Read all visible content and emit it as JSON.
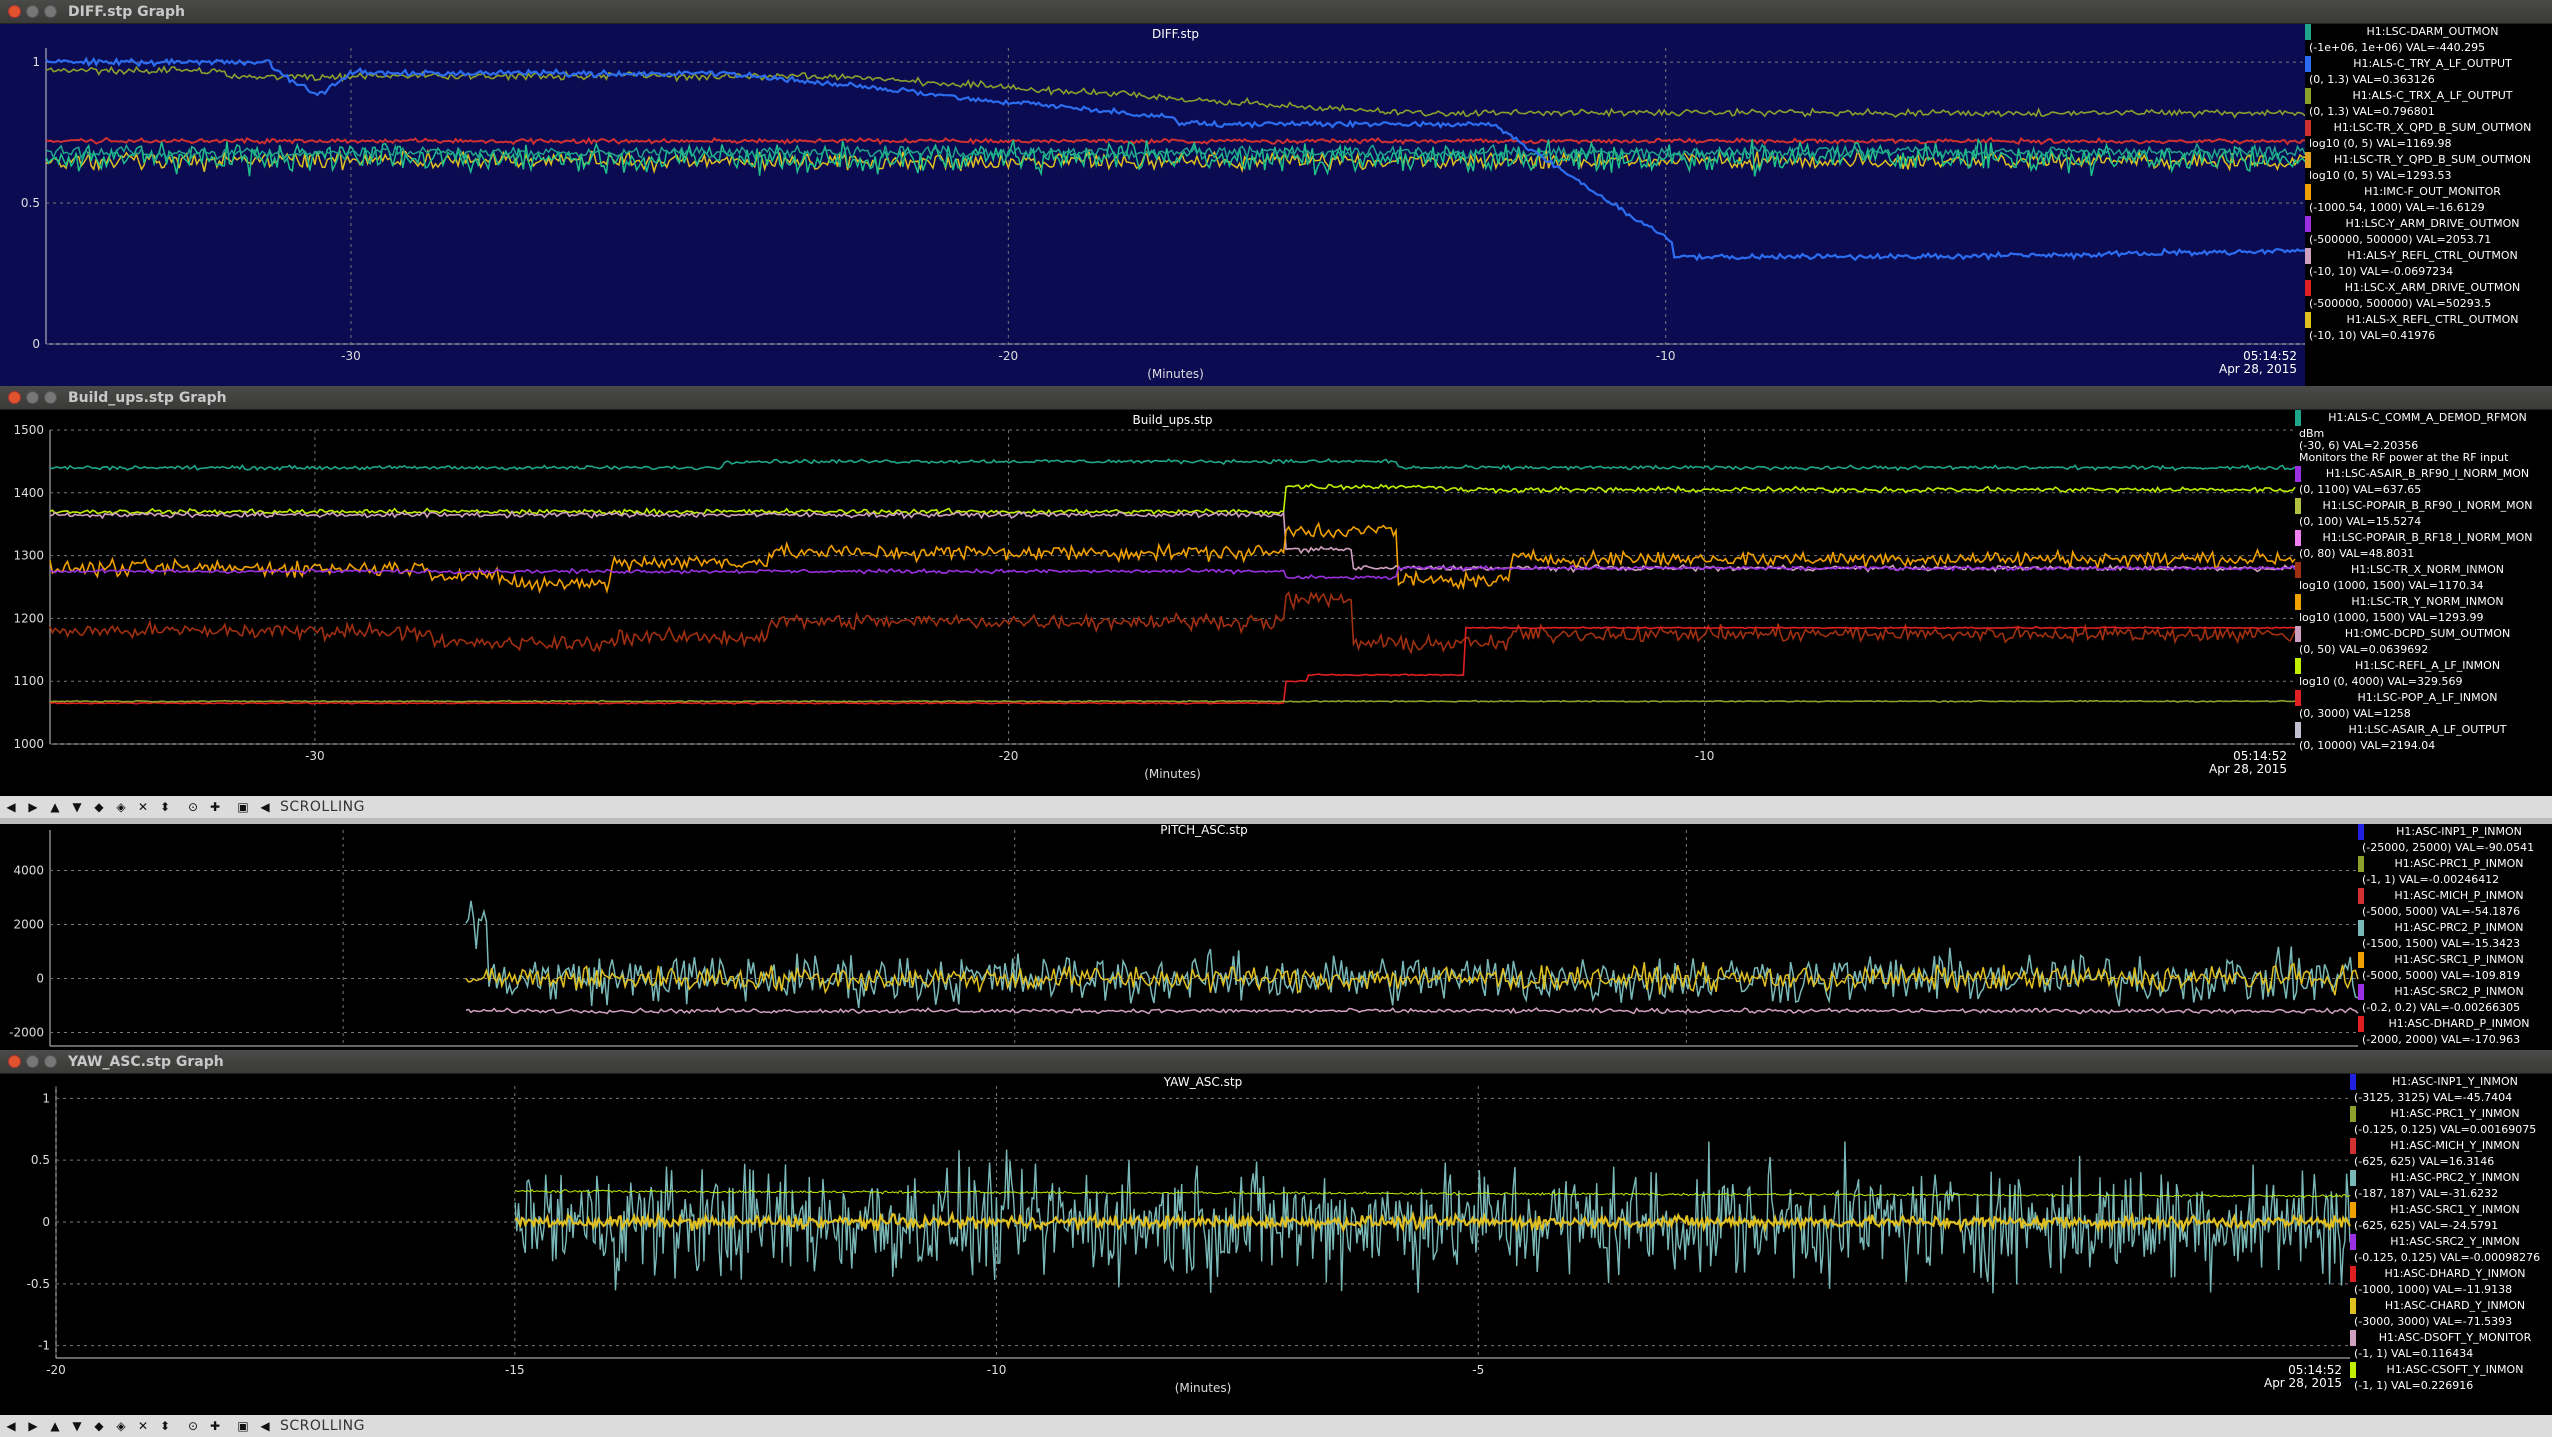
{
  "panels": [
    {
      "window_title": "DIFF.stp Graph",
      "plot_title": "DIFF.stp",
      "bg": "#0b0b52",
      "x_ticks": [
        "-30",
        "-20",
        "-10"
      ],
      "y_ticks": [
        "1",
        "0.5",
        "0"
      ],
      "x_label": "(Minutes)",
      "timestamp_time": "05:14:52",
      "timestamp_date": "Apr 28, 2015",
      "legend": [
        {
          "name": "H1:LSC-DARM_OUTMON",
          "range": "(-1e+06, 1e+06) VAL=-440.295",
          "color": "#1fa58a"
        },
        {
          "name": "H1:ALS-C_TRY_A_LF_OUTPUT",
          "range": "(0, 1.3) VAL=0.363126",
          "color": "#2c6df0"
        },
        {
          "name": "H1:ALS-C_TRX_A_LF_OUTPUT",
          "range": "(0, 1.3) VAL=0.796801",
          "color": "#8ca02c"
        },
        {
          "name": "H1:LSC-TR_X_QPD_B_SUM_OUTMON",
          "range": "log10 (0, 5) VAL=1169.98",
          "color": "#d03030"
        },
        {
          "name": "H1:LSC-TR_Y_QPD_B_SUM_OUTMON",
          "range": "log10 (0, 5) VAL=1293.53",
          "color": "#e0a020"
        },
        {
          "name": "H1:IMC-F_OUT_MONITOR",
          "range": "(-1000.54, 1000) VAL=-16.6129",
          "color": "#f0a000"
        },
        {
          "name": "H1:LSC-Y_ARM_DRIVE_OUTMON",
          "range": "(-500000, 500000) VAL=2053.71",
          "color": "#9a30e0"
        },
        {
          "name": "H1:ALS-Y_REFL_CTRL_OUTMON",
          "range": "(-10, 10) VAL=-0.0697234",
          "color": "#d0a0c0"
        },
        {
          "name": "H1:LSC-X_ARM_DRIVE_OUTMON",
          "range": "(-500000, 500000) VAL=50293.5",
          "color": "#e02020"
        },
        {
          "name": "H1:ALS-X_REFL_CTRL_OUTMON",
          "range": "(-10, 10) VAL=0.41976",
          "color": "#e0c020"
        }
      ]
    },
    {
      "window_title": "Build_ups.stp Graph",
      "plot_title": "Build_ups.stp",
      "bg": "#000000",
      "x_ticks": [
        "-30",
        "-20",
        "-10"
      ],
      "y_ticks": [
        "1500",
        "1400",
        "1300",
        "1200",
        "1100",
        "1000"
      ],
      "x_label": "(Minutes)",
      "timestamp_time": "05:14:52",
      "timestamp_date": "Apr 28, 2015",
      "legend": [
        {
          "name": "H1:ALS-C_COMM_A_DEMOD_RFMON",
          "range": "dBm",
          "extra": "(-30, 6) VAL=2.20356",
          "desc": "Monitors the RF power at the RF input",
          "color": "#1fa58a"
        },
        {
          "name": "H1:LSC-ASAIR_B_RF90_I_NORM_MON",
          "range": "(0, 1100) VAL=637.65",
          "color": "#9a30e0"
        },
        {
          "name": "H1:LSC-POPAIR_B_RF90_I_NORM_MON",
          "range": "(0, 100) VAL=15.5274",
          "color": "#b0c040"
        },
        {
          "name": "H1:LSC-POPAIR_B_RF18_I_NORM_MON",
          "range": "(0, 80) VAL=48.8031",
          "color": "#f080f0"
        },
        {
          "name": "H1:LSC-TR_X_NORM_INMON",
          "range": "log10 (1000, 1500) VAL=1170.34",
          "color": "#a03010"
        },
        {
          "name": "H1:LSC-TR_Y_NORM_INMON",
          "range": "log10 (1000, 1500) VAL=1293.99",
          "color": "#f0a000"
        },
        {
          "name": "H1:OMC-DCPD_SUM_OUTMON",
          "range": "(0, 50) VAL=0.0639692",
          "color": "#d0a0c0"
        },
        {
          "name": "H1:LSC-REFL_A_LF_INMON",
          "range": "log10 (0, 4000) VAL=329.569",
          "color": "#c0f000"
        },
        {
          "name": "H1:LSC-POP_A_LF_INMON",
          "range": "(0, 3000) VAL=1258",
          "color": "#e02020"
        },
        {
          "name": "H1:LSC-ASAIR_A_LF_OUTPUT",
          "range": "(0, 10000) VAL=2194.04",
          "color": "#c0c0d0"
        }
      ],
      "toolbar": {
        "mode": "SCROLLING"
      }
    },
    {
      "window_title": "",
      "plot_title": "PITCH_ASC.stp",
      "bg": "#000000",
      "x_ticks": [],
      "y_ticks": [
        "4000",
        "2000",
        "0",
        "-2000"
      ],
      "legend": [
        {
          "name": "H1:ASC-INP1_P_INMON",
          "range": "(-25000, 25000) VAL=-90.0541",
          "color": "#2020e0"
        },
        {
          "name": "H1:ASC-PRC1_P_INMON",
          "range": "(-1, 1) VAL=-0.00246412",
          "color": "#8ca02c"
        },
        {
          "name": "H1:ASC-MICH_P_INMON",
          "range": "(-5000, 5000) VAL=-54.1876",
          "color": "#d03030"
        },
        {
          "name": "H1:ASC-PRC2_P_INMON",
          "range": "(-1500, 1500) VAL=-15.3423",
          "color": "#7ab8b8"
        },
        {
          "name": "H1:ASC-SRC1_P_INMON",
          "range": "(-5000, 5000) VAL=-109.819",
          "color": "#f0a000"
        },
        {
          "name": "H1:ASC-SRC2_P_INMON",
          "range": "(-0.2, 0.2) VAL=-0.00266305",
          "color": "#9a30e0"
        },
        {
          "name": "H1:ASC-DHARD_P_INMON",
          "range": "(-2000, 2000) VAL=-170.963",
          "color": "#e02020"
        }
      ]
    },
    {
      "window_title": "YAW_ASC.stp Graph",
      "plot_title": "YAW_ASC.stp",
      "bg": "#000000",
      "x_ticks": [
        "-20",
        "-15",
        "-10",
        "-5"
      ],
      "y_ticks": [
        "1",
        "0.5",
        "0",
        "-0.5",
        "-1"
      ],
      "x_label": "(Minutes)",
      "timestamp_time": "05:14:52",
      "timestamp_date": "Apr 28, 2015",
      "legend": [
        {
          "name": "H1:ASC-INP1_Y_INMON",
          "range": "(-3125, 3125) VAL=-45.7404",
          "color": "#2020e0"
        },
        {
          "name": "H1:ASC-PRC1_Y_INMON",
          "range": "(-0.125, 0.125) VAL=0.00169075",
          "color": "#8ca02c"
        },
        {
          "name": "H1:ASC-MICH_Y_INMON",
          "range": "(-625, 625) VAL=16.3146",
          "color": "#d03030"
        },
        {
          "name": "H1:ASC-PRC2_Y_INMON",
          "range": "(-187, 187) VAL=-31.6232",
          "color": "#7ab8b8"
        },
        {
          "name": "H1:ASC-SRC1_Y_INMON",
          "range": "(-625, 625) VAL=-24.5791",
          "color": "#f0a000"
        },
        {
          "name": "H1:ASC-SRC2_Y_INMON",
          "range": "(-0.125, 0.125) VAL=-0.00098276",
          "color": "#9a30e0"
        },
        {
          "name": "H1:ASC-DHARD_Y_INMON",
          "range": "(-1000, 1000) VAL=-11.9138",
          "color": "#e02020"
        },
        {
          "name": "H1:ASC-CHARD_Y_INMON",
          "range": "(-3000, 3000) VAL=-71.5393",
          "color": "#e0c020"
        },
        {
          "name": "H1:ASC-DSOFT_Y_MONITOR",
          "range": "(-1, 1) VAL=0.116434",
          "color": "#d0a0c0"
        },
        {
          "name": "H1:ASC-CSOFT_Y_INMON",
          "range": "(-1, 1) VAL=0.226916",
          "color": "#c0f000"
        }
      ],
      "toolbar": {
        "mode": "SCROLLING"
      }
    }
  ]
}
